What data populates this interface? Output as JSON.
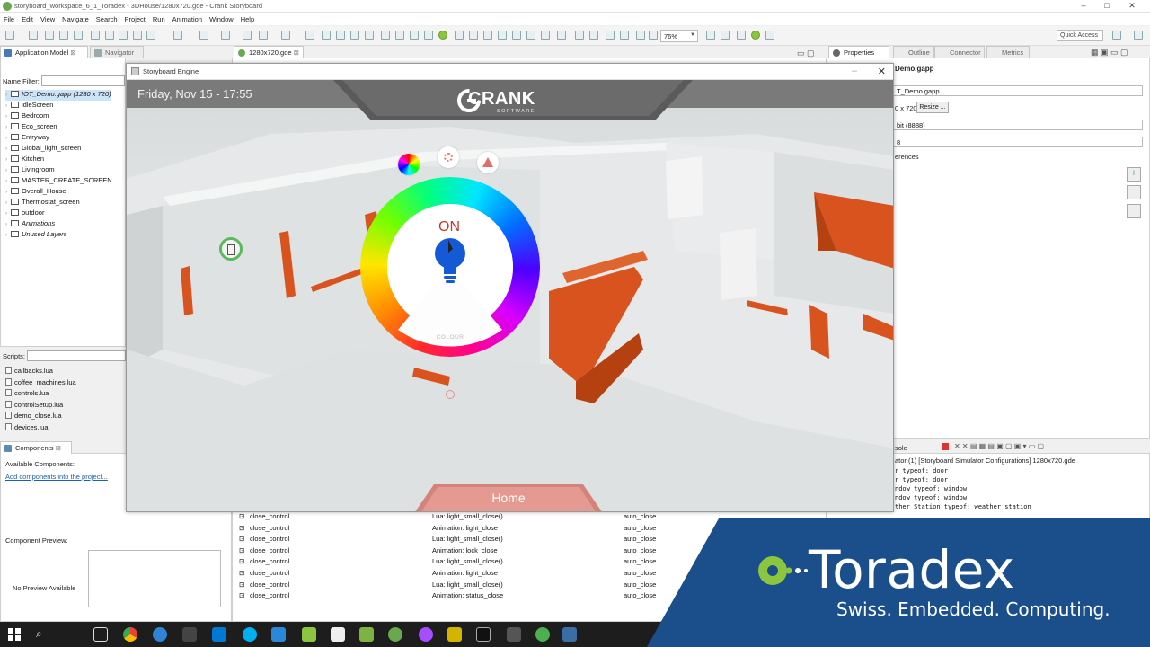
{
  "window": {
    "title": "storyboard_workspace_6_1_Toradex - 3DHouse/1280x720.gde - Crank Storyboard",
    "controls": [
      "–",
      "□",
      "✕"
    ]
  },
  "menu": [
    "File",
    "Edit",
    "View",
    "Navigate",
    "Search",
    "Project",
    "Run",
    "Animation",
    "Window",
    "Help"
  ],
  "toolbar": {
    "zoom": "76%",
    "quick_access": "Quick Access"
  },
  "left_panel": {
    "tabs": [
      "Application Model",
      "Navigator"
    ],
    "filter_label": "Name Filter:",
    "tree": [
      {
        "label": "IOT_Demo.gapp (1280 x 720)",
        "italic": true,
        "selected": true
      },
      {
        "label": "idleScreen"
      },
      {
        "label": "Bedroom"
      },
      {
        "label": "Eco_screen"
      },
      {
        "label": "Entryway"
      },
      {
        "label": "Global_light_screen"
      },
      {
        "label": "Kitchen"
      },
      {
        "label": "Livingroom"
      },
      {
        "label": "MASTER_CREATE_SCREEN"
      },
      {
        "label": "Overall_House"
      },
      {
        "label": "Thermostat_screen"
      },
      {
        "label": "outdoor"
      },
      {
        "label": "Animations",
        "italic": true
      },
      {
        "label": "Unused Layers",
        "italic": true
      }
    ],
    "scripts_label": "Scripts:",
    "scripts": [
      "callbacks.lua",
      "coffee_machines.lua",
      "controls.lua",
      "controlSetup.lua",
      "demo_close.lua",
      "devices.lua"
    ]
  },
  "components": {
    "tab": "Components",
    "available_label": "Available Components:",
    "add_link": "Add components into the project...",
    "preview_label": "Component Preview:",
    "no_preview": "No Preview Available"
  },
  "editor_tab": "1280x720.gde",
  "properties": {
    "tabs": [
      "Properties",
      "Outline",
      "Connector",
      "Metrics"
    ],
    "file_header": "Demo.gapp",
    "file_value": "T_Demo.gapp",
    "size_value": "0 x 720",
    "resize_label": "Resize ...",
    "bit_value": "bit (8888)",
    "field2": "8",
    "references_label": "erences"
  },
  "event_table": [
    {
      "event": "close_control",
      "action": "Lua: light_small_close()",
      "target": "auto_close"
    },
    {
      "event": "close_control",
      "action": "Animation: light_close",
      "target": "auto_close"
    },
    {
      "event": "close_control",
      "action": "Lua: light_small_close()",
      "target": "auto_close"
    },
    {
      "event": "close_control",
      "action": "Animation: lock_close",
      "target": "auto_close"
    },
    {
      "event": "close_control",
      "action": "Lua: light_small_close()",
      "target": "auto_close"
    },
    {
      "event": "close_control",
      "action": "Animation: light_close",
      "target": "auto_close"
    },
    {
      "event": "close_control",
      "action": "Lua: light_small_close()",
      "target": "auto_close"
    },
    {
      "event": "close_control",
      "action": "Animation: status_close",
      "target": "auto_close"
    }
  ],
  "console": {
    "tab": "sole",
    "header": "ator (1) [Storyboard Simulator Configurations] 1280x720.gde",
    "lines": [
      "r typeof: door",
      "r typeof: door",
      "ndow typeof: window",
      "ndow typeof: window",
      "ther Station typeof: weather_station"
    ]
  },
  "simulator": {
    "title": "Storyboard Engine",
    "datetime": "Friday, Nov 15 - 17:55",
    "brand": "CRANK",
    "brand_sub": "SOFTWARE",
    "light_state": "ON",
    "dial_label": "COLOUR",
    "home": "Home"
  },
  "overlay": {
    "name": "Toradex",
    "tagline": "Swiss. Embedded. Computing.",
    "background": "#1b4f8c",
    "accent": "#8cc63f"
  },
  "colors": {
    "scene_orange": "#d9531e",
    "brand_gray": "#7a7a7a",
    "home_red": "#e07b6f"
  }
}
